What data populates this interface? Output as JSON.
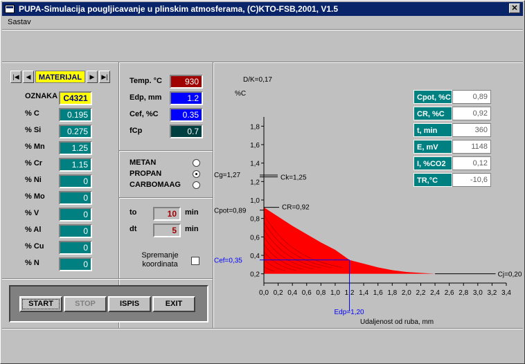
{
  "window": {
    "title": "PUPA-Simulacija pougljicavanje u plinskim atmosferama, (C)KTO-FSB,2001, V1.5",
    "close_label": "✕"
  },
  "menu": {
    "items": [
      "Sastav"
    ]
  },
  "material": {
    "nav_label": "MATERIJAL",
    "oznaka_label": "OZNAKA",
    "oznaka_value": "C4321",
    "elements": [
      {
        "label": "% C",
        "value": "0.195"
      },
      {
        "label": "% Si",
        "value": "0.275"
      },
      {
        "label": "% Mn",
        "value": "1.25"
      },
      {
        "label": "% Cr",
        "value": "1.15"
      },
      {
        "label": "% Ni",
        "value": "0"
      },
      {
        "label": "% Mo",
        "value": "0"
      },
      {
        "label": "% V",
        "value": "0"
      },
      {
        "label": "% Al",
        "value": "0"
      },
      {
        "label": "% Cu",
        "value": "0"
      },
      {
        "label": "% N",
        "value": "0"
      }
    ]
  },
  "process": {
    "temp_label": "Temp. °C",
    "temp_value": "930",
    "temp_color": "#a00000",
    "edp_label": "Edp, mm",
    "edp_value": "1.2",
    "edp_color": "#0000ff",
    "cef_label": "Cef, %C",
    "cef_value": "0.35",
    "cef_color": "#0000ff",
    "fcp_label": "fCp",
    "fcp_value": "0.7",
    "fcp_color": "#004040"
  },
  "gas": {
    "options": [
      {
        "label": "METAN",
        "selected": false
      },
      {
        "label": "PROPAN",
        "selected": true
      },
      {
        "label": "CARBOMAAG",
        "selected": false
      }
    ]
  },
  "timing": {
    "to_label": "to",
    "to_value": "10",
    "to_unit": "min",
    "dt_label": "dt",
    "dt_value": "5",
    "dt_unit": "min",
    "save_label": "Spremanje koordinata"
  },
  "buttons": {
    "start": "START",
    "stop": "STOP",
    "ispis": "ISPIS",
    "exit": "EXIT"
  },
  "results": [
    {
      "label": "Cpot, %C",
      "value": "0,89"
    },
    {
      "label": "CR, %C",
      "value": "0,92"
    },
    {
      "label": "t, min",
      "value": "360"
    },
    {
      "label": "E, mV",
      "value": "1148"
    },
    {
      "label": "I, %CO2",
      "value": "0,12"
    },
    {
      "label": "TR,°C",
      "value": "-10,6"
    }
  ],
  "chart_data": {
    "type": "area",
    "title": "D/K=0,17",
    "ylabel": "%C",
    "xlabel": "Udaljenost od ruba, mm",
    "xlim": [
      0,
      3.4
    ],
    "ylim": [
      0.1,
      1.9
    ],
    "x_ticks": [
      "0,0",
      "0,2",
      "0,4",
      "0,6",
      "0,8",
      "1,0",
      "1,2",
      "1,4",
      "1,6",
      "1,8",
      "2,0",
      "2,2",
      "2,4",
      "2,6",
      "2,8",
      "3,0",
      "3,2",
      "3,4"
    ],
    "y_ticks": [
      "0,2",
      "0,4",
      "0,6",
      "0,8",
      "1,0",
      "1,2",
      "1,4",
      "1,6",
      "1,8"
    ],
    "annotations": {
      "cg": "Cg=1,27",
      "ck": "Ck=1,25",
      "cpot": "Cpot=0,89",
      "cr": "CR=0,92",
      "cef": "Cef=0,35",
      "edp": "Edp=1,20",
      "cj": "Cj=0,20"
    },
    "reference": {
      "cg": 1.27,
      "ck": 1.25,
      "cpot": 0.89,
      "cr": 0.92,
      "cef": 0.35,
      "edp": 1.2,
      "cj": 0.2
    },
    "series": [
      {
        "x": [
          0,
          0.2,
          0.4,
          0.6,
          0.8,
          1.0,
          1.2,
          1.4,
          1.6,
          1.8,
          2.0,
          2.2,
          2.4,
          2.6
        ],
        "values": [
          0.92,
          0.82,
          0.72,
          0.63,
          0.54,
          0.46,
          0.35,
          0.31,
          0.27,
          0.24,
          0.22,
          0.21,
          0.2,
          0.2
        ]
      }
    ],
    "color": "#ff0000"
  }
}
